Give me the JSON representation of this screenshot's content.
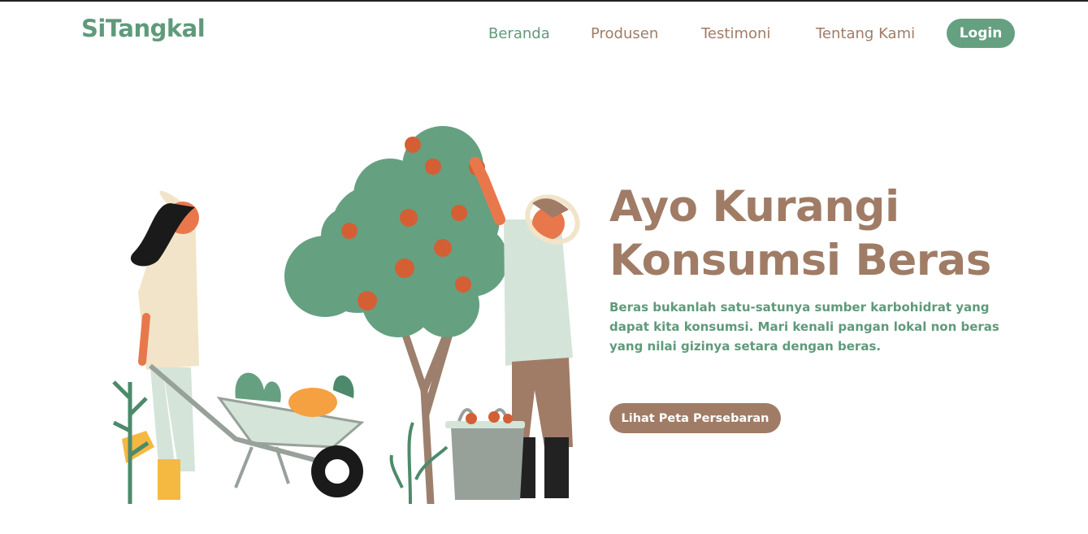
{
  "brand": {
    "name": "SiTangkal"
  },
  "nav": {
    "items": [
      {
        "label": "Beranda",
        "active": true
      },
      {
        "label": "Produsen",
        "active": false
      },
      {
        "label": "Testimoni",
        "active": false
      },
      {
        "label": "Tentang Kami",
        "active": false
      }
    ],
    "login_label": "Login"
  },
  "hero": {
    "title_line1": "Ayo Kurangi",
    "title_line2": "Konsumsi Beras",
    "description": "Beras bukanlah satu-satunya sumber karbohidrat yang dapat kita konsumsi. Mari kenali pangan lokal non beras yang nilai gizinya setara dengan beras.",
    "cta_label": "Lihat Peta Persebaran"
  },
  "colors": {
    "primary_green": "#5f9a7a",
    "primary_brown": "#a07c66",
    "background": "#ffffff"
  },
  "icons": [
    "farming-illustration"
  ]
}
